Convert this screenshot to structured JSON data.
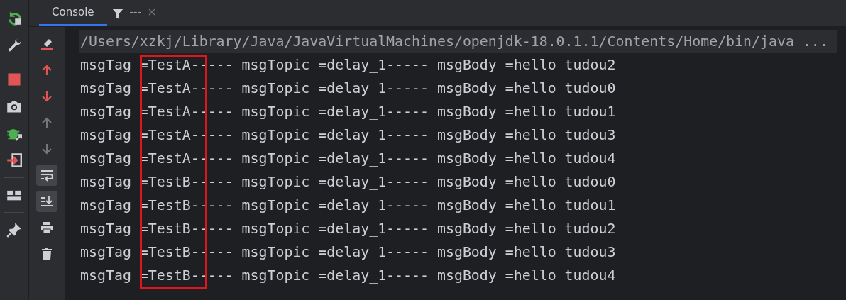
{
  "side_toolbar": [
    {
      "kind": "rerun"
    },
    {
      "kind": "wrench"
    },
    {
      "kind": "sep"
    },
    {
      "kind": "stop"
    },
    {
      "kind": "camera"
    },
    {
      "kind": "bug"
    },
    {
      "kind": "login"
    },
    {
      "kind": "sep"
    },
    {
      "kind": "layout"
    },
    {
      "kind": "sep"
    },
    {
      "kind": "pin"
    }
  ],
  "tabs": [
    {
      "kind": "text",
      "label": "Console",
      "selected": true
    },
    {
      "kind": "filter",
      "label": "---",
      "selected": false
    }
  ],
  "console_toolbar": [
    {
      "kind": "clear",
      "disabled": false,
      "toggled": false
    },
    {
      "kind": "up-red",
      "disabled": false,
      "toggled": false
    },
    {
      "kind": "down-red",
      "disabled": false,
      "toggled": false
    },
    {
      "kind": "up",
      "disabled": true,
      "toggled": false
    },
    {
      "kind": "down",
      "disabled": true,
      "toggled": false
    },
    {
      "kind": "wrap",
      "disabled": false,
      "toggled": true
    },
    {
      "kind": "scroll-end",
      "disabled": false,
      "toggled": true
    },
    {
      "kind": "print",
      "disabled": false,
      "toggled": false
    },
    {
      "kind": "trash",
      "disabled": false,
      "toggled": false
    }
  ],
  "console": {
    "command": "/Users/xzkj/Library/Java/JavaVirtualMachines/openjdk-18.0.1.1/Contents/Home/bin/java ...",
    "lines": [
      "msgTag =TestA----- msgTopic =delay_1----- msgBody =hello tudou2",
      "msgTag =TestA----- msgTopic =delay_1----- msgBody =hello tudou0",
      "msgTag =TestA----- msgTopic =delay_1----- msgBody =hello tudou1",
      "msgTag =TestA----- msgTopic =delay_1----- msgBody =hello tudou3",
      "msgTag =TestA----- msgTopic =delay_1----- msgBody =hello tudou4",
      "msgTag =TestB----- msgTopic =delay_1----- msgBody =hello tudou0",
      "msgTag =TestB----- msgTopic =delay_1----- msgBody =hello tudou1",
      "msgTag =TestB----- msgTopic =delay_1----- msgBody =hello tudou2",
      "msgTag =TestB----- msgTopic =delay_1----- msgBody =hello tudou3",
      "msgTag =TestB----- msgTopic =delay_1----- msgBody =hello tudou4"
    ]
  }
}
